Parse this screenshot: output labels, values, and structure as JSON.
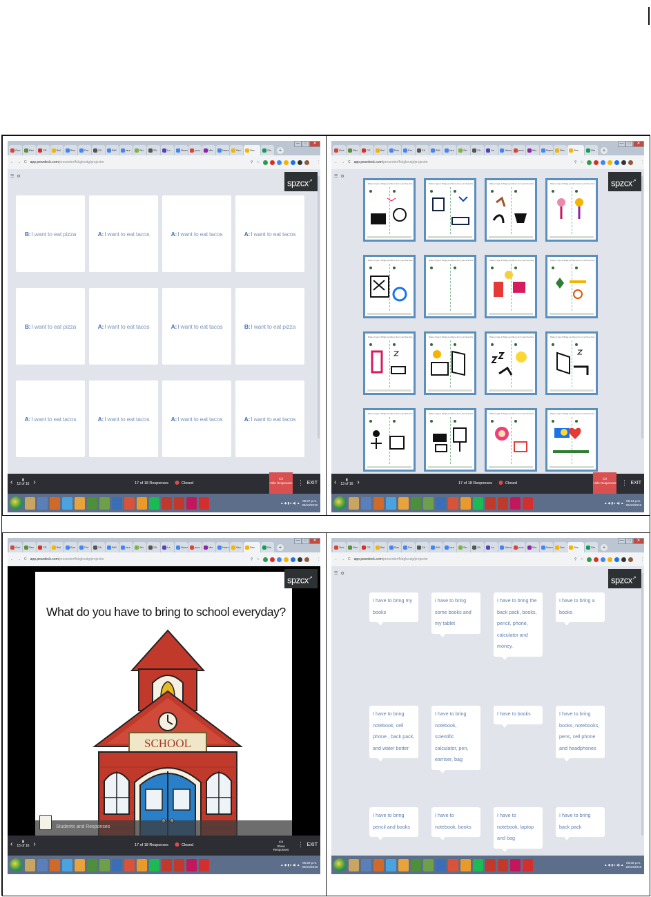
{
  "browser": {
    "url_host": "app.peardeck.com",
    "url_path": "/presenter/fcbgkvutg/projector",
    "tabs": [
      "Gmi",
      "Rec",
      "CE",
      "Bal",
      "Bus",
      "Pro",
      "ZA",
      "BNI",
      "Iaur",
      "Sin",
      "ZA",
      "La",
      "Nuevo",
      "proc",
      "Mis",
      "Nuevo",
      "Sec",
      "Sec",
      "Stu"
    ],
    "tab_colors": [
      "#d44638",
      "#5b8f3c",
      "#d93025",
      "#f4b400",
      "#4285f4",
      "#4285f4",
      "#555555",
      "#4285f4",
      "#4285f4",
      "#7cb342",
      "#555555",
      "#5c3fb5",
      "#4285f4",
      "#db4437",
      "#8e24aa",
      "#4285f4",
      "#f4b400",
      "#f4b400",
      "#0f9d58"
    ],
    "window_buttons": [
      "—",
      "□",
      "✕"
    ]
  },
  "logo_text": "spzcx",
  "panel1": {
    "cards": [
      {
        "label": "B:",
        "text": "I want to eat pizza"
      },
      {
        "label": "A:",
        "text": "I want to eat tacos"
      },
      {
        "label": "A:",
        "text": "I want to eat tacos"
      },
      {
        "label": "A:",
        "text": "I want to eat tacos"
      },
      {
        "label": "B:",
        "text": "I want to eat pizza"
      },
      {
        "label": "A:",
        "text": "I want to eat tacos"
      },
      {
        "label": "A:",
        "text": "I want to eat tacos"
      },
      {
        "label": "B:",
        "text": "I want to eat pizza"
      },
      {
        "label": "A:",
        "text": "I want to eat tacos"
      },
      {
        "label": "A:",
        "text": "I want to eat tacos"
      },
      {
        "label": "A:",
        "text": "I want to eat tacos"
      },
      {
        "label": "A:",
        "text": "I want to eat tacos"
      }
    ],
    "slide_counter": "12 of 16",
    "responses": "17 of 18 Responses",
    "status": "Closed",
    "toggle_label": "Hide Responses",
    "exit": "EXIT",
    "clock_time": "06:07 p.m.",
    "clock_date": "29/10/2019"
  },
  "panel2": {
    "prompt": "Draw or type 2 things you like to do in your free time",
    "slide_counter": "13 of 16",
    "responses": "17 of 18 Responses",
    "status": "Closed",
    "toggle_label": "Hide Responses",
    "exit": "EXIT",
    "clock_time": "06:24 p.m.",
    "clock_date": "29/10/2019",
    "drawing_count": 16
  },
  "panel3": {
    "slide_title": "What do you have to bring to school everyday?",
    "school_sign": "SCHOOL",
    "overlay_label": "Students and Responses",
    "slide_counter": "15 of 16",
    "responses": "17 of 18 Responses",
    "status": "Closed",
    "toggle_label": "Show Responses",
    "exit": "EXIT",
    "clock_time": "06:29 p.m.",
    "clock_date": "29/10/2019"
  },
  "panel4": {
    "bubbles": [
      "I have to bring my books",
      "i have to bring some books and my tablet",
      "I have to bring the back pack, books, pencil, phone, calculator and money.",
      "I have to bring a books",
      "I have to bring notebook, cell phone , back pack, and water botter",
      "I have to bring notebook,  scientific calculator, pen, earriser, bag",
      "I have to books",
      "I have to bring books, notebooks, pens, cell phone and headphones",
      "I have to bring pencil and books",
      "I have to notebook, books",
      "I have to  notebook, laptop and bag",
      "I have to bring back pack"
    ],
    "clock_time": "06:30 p.m.",
    "clock_date": "29/10/2019"
  },
  "taskbar_colors": [
    "#c8a560",
    "#5b7fb8",
    "#d06a2a",
    "#4aa3df",
    "#e8a33a",
    "#4e8f3a",
    "#6ea04a",
    "#3a6fb8",
    "#d9533a",
    "#e89b2a",
    "#1db954",
    "#c0392b",
    "#c0392b",
    "#c2185b",
    "#d32f2f"
  ],
  "tray_icons": "▲ ◆ ▮ ▸ ◀) ▲"
}
